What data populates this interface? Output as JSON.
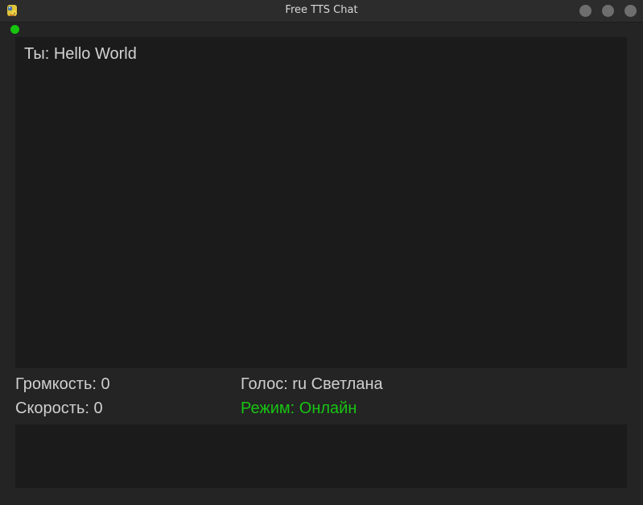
{
  "window": {
    "title": "Free TTS Chat"
  },
  "icons": {
    "app": "python-snake-icon",
    "status": "status-dot-icon"
  },
  "colors": {
    "online": "#17c40d",
    "background": "#242424",
    "panel": "#1b1b1b",
    "text": "#d2d2d2"
  },
  "chat": {
    "messages": [
      {
        "text": "Ты: Hello World"
      }
    ]
  },
  "status": {
    "volume": "Громкость: 0",
    "speed": "Скорость: 0",
    "voice": "Голос: ru Светлана",
    "mode": "Режим: Онлайн"
  },
  "input": {
    "value": ""
  }
}
